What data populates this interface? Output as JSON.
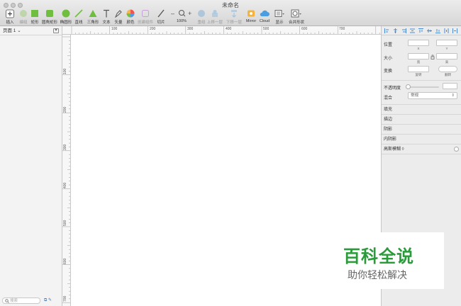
{
  "window": {
    "title": "未命名"
  },
  "toolbar": {
    "items": [
      {
        "label": "插入",
        "icon": "plus-icon"
      },
      {
        "label": "编组",
        "icon": "group-icon",
        "disabled": true
      },
      {
        "label": "矩形",
        "icon": "rectangle-icon"
      },
      {
        "label": "圆角矩形",
        "icon": "rounded-rectangle-icon"
      },
      {
        "label": "椭圆形",
        "icon": "oval-icon"
      },
      {
        "label": "直线",
        "icon": "line-icon"
      },
      {
        "label": "三角形",
        "icon": "triangle-icon"
      },
      {
        "label": "文本",
        "icon": "text-icon"
      },
      {
        "label": "矢量",
        "icon": "vector-pen-icon"
      },
      {
        "label": "颜色",
        "icon": "color-wheel-icon"
      },
      {
        "label": "创建组件",
        "icon": "create-symbol-icon",
        "disabled": true
      },
      {
        "label": "切片",
        "icon": "slice-icon"
      },
      {
        "label": "100%",
        "icon": "zoom-icon"
      },
      {
        "label": "重组",
        "icon": "regroup-icon",
        "disabled": true
      },
      {
        "label": "上移一层",
        "icon": "forward-icon",
        "disabled": true
      },
      {
        "label": "下移一层",
        "icon": "backward-icon",
        "disabled": true
      },
      {
        "label": "Mirror",
        "icon": "mirror-icon"
      },
      {
        "label": "Cloud",
        "icon": "cloud-icon"
      },
      {
        "label": "显示",
        "icon": "view-icon"
      },
      {
        "label": "合并形状",
        "icon": "combine-shapes-icon"
      }
    ]
  },
  "sidebar": {
    "page_label": "页面 1 ⌄",
    "search_placeholder": "搜索"
  },
  "ruler": {
    "top_ticks": [
      "100",
      "200",
      "300",
      "400",
      "500",
      "600",
      "700"
    ],
    "left_ticks": [
      "100",
      "200",
      "300",
      "400",
      "500",
      "600",
      "700"
    ]
  },
  "inspector": {
    "position_label": "位置",
    "x_label": "X",
    "y_label": "Y",
    "size_label": "大小",
    "width_label": "宽",
    "height_label": "高",
    "transform_label": "变换",
    "rotate_label": "旋转",
    "flip_label": "翻转",
    "opacity_label": "不透明度",
    "blend_label": "混合",
    "blend_value": "常规",
    "sections": [
      "填充",
      "描边",
      "阴影",
      "内阴影",
      "高斯模糊 ◊"
    ]
  },
  "watermark": {
    "title": "百科全说",
    "subtitle": "助你轻松解决"
  },
  "colors": {
    "accent": "#3a79c4",
    "canvas": "#ffffff",
    "brand_green": "#2a9a3a"
  }
}
